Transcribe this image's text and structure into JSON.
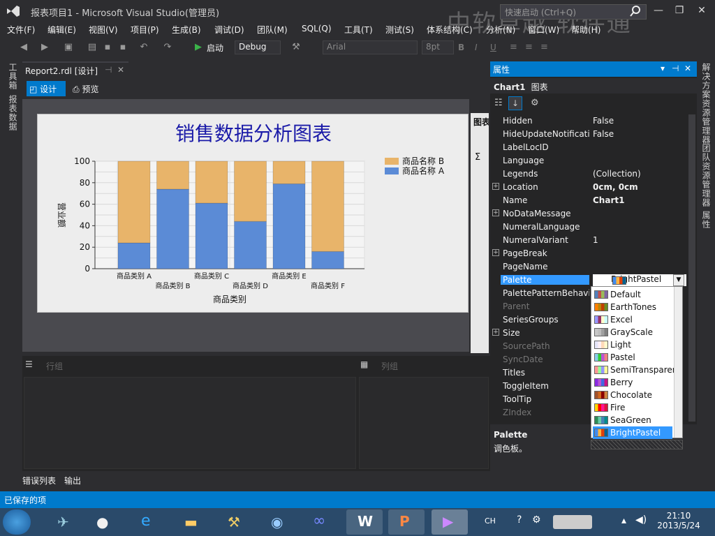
{
  "window": {
    "title": "报表项目1 - Microsoft Visual Studio(管理员)",
    "quick_launch_placeholder": "快速启动 (Ctrl+Q)",
    "watermark": "中软卓越 软件通"
  },
  "menu": [
    "文件(F)",
    "编辑(E)",
    "视图(V)",
    "项目(P)",
    "生成(B)",
    "调试(D)",
    "团队(M)",
    "SQL(Q)",
    "工具(T)",
    "测试(S)",
    "体系结构(C)",
    "分析(N)",
    "窗口(W)",
    "帮助(H)"
  ],
  "toolbar": {
    "start_label": "启动",
    "config": "Debug",
    "font": "Arial",
    "font_size": "8pt"
  },
  "left_strip": {
    "toolbox": "工具箱",
    "report_data": "报表数据"
  },
  "document": {
    "tab_title": "Report2.rdl [设计]",
    "design_tab": "设计",
    "preview_tab": "预览"
  },
  "side_panel": {
    "title": "图表"
  },
  "chart_data": {
    "type": "bar",
    "stacked": true,
    "title": "销售数据分析图表",
    "xlabel": "商品类别",
    "ylabel": "营业额",
    "ylim": [
      0,
      100
    ],
    "yticks": [
      0,
      20,
      40,
      60,
      80,
      100
    ],
    "categories": [
      "商品类别 A",
      "商品类别 B",
      "商品类别 C",
      "商品类别 D",
      "商品类别 E",
      "商品类别 F"
    ],
    "series": [
      {
        "name": "商品名称 A",
        "color": "#5b8bd6",
        "values": [
          24,
          74,
          61,
          44,
          79,
          16
        ]
      },
      {
        "name": "商品名称 B",
        "color": "#e8b46a",
        "values": [
          76,
          26,
          39,
          56,
          21,
          84
        ]
      }
    ],
    "legend": [
      "商品名称 B",
      "商品名称 A"
    ],
    "legend_position": "top-right",
    "grid": true
  },
  "groups": {
    "row_groups": "行组",
    "column_groups": "列组"
  },
  "bottom_tabs": [
    "错误列表",
    "输出"
  ],
  "status": "已保存的项",
  "properties": {
    "panel_title": "属性",
    "object": "Chart1",
    "object_type": "图表",
    "rows": [
      {
        "name": "Hidden",
        "value": "False",
        "expandable": false,
        "dim": false,
        "bold": false
      },
      {
        "name": "HideUpdateNotifications",
        "value": "False",
        "expandable": false,
        "dim": false,
        "bold": false
      },
      {
        "name": "LabelLocID",
        "value": "",
        "expandable": false,
        "dim": false,
        "bold": false
      },
      {
        "name": "Language",
        "value": "",
        "expandable": false,
        "dim": false,
        "bold": false
      },
      {
        "name": "Legends",
        "value": "(Collection)",
        "expandable": false,
        "dim": false,
        "bold": false
      },
      {
        "name": "Location",
        "value": "0cm, 0cm",
        "expandable": true,
        "dim": false,
        "bold": true
      },
      {
        "name": "Name",
        "value": "Chart1",
        "expandable": false,
        "dim": false,
        "bold": true
      },
      {
        "name": "NoDataMessage",
        "value": "",
        "expandable": true,
        "dim": false,
        "bold": false
      },
      {
        "name": "NumeralLanguage",
        "value": "",
        "expandable": false,
        "dim": false,
        "bold": false
      },
      {
        "name": "NumeralVariant",
        "value": "1",
        "expandable": false,
        "dim": false,
        "bold": false
      },
      {
        "name": "PageBreak",
        "value": "",
        "expandable": true,
        "dim": false,
        "bold": false
      },
      {
        "name": "PageName",
        "value": "",
        "expandable": false,
        "dim": false,
        "bold": false
      },
      {
        "name": "Palette",
        "value": "BrightPastel",
        "expandable": false,
        "dim": false,
        "bold": false,
        "selected": true
      },
      {
        "name": "PalettePatternBehavior",
        "value": "",
        "expandable": false,
        "dim": false,
        "bold": false
      },
      {
        "name": "Parent",
        "value": "",
        "expandable": false,
        "dim": true,
        "bold": false
      },
      {
        "name": "SeriesGroups",
        "value": "",
        "expandable": false,
        "dim": false,
        "bold": false
      },
      {
        "name": "Size",
        "value": "",
        "expandable": true,
        "dim": false,
        "bold": false
      },
      {
        "name": "SourcePath",
        "value": "",
        "expandable": false,
        "dim": true,
        "bold": false
      },
      {
        "name": "SyncDate",
        "value": "",
        "expandable": false,
        "dim": true,
        "bold": false
      },
      {
        "name": "Titles",
        "value": "",
        "expandable": false,
        "dim": false,
        "bold": false
      },
      {
        "name": "ToggleItem",
        "value": "",
        "expandable": false,
        "dim": false,
        "bold": false
      },
      {
        "name": "ToolTip",
        "value": "",
        "expandable": false,
        "dim": false,
        "bold": false
      },
      {
        "name": "ZIndex",
        "value": "",
        "expandable": false,
        "dim": true,
        "bold": false
      }
    ],
    "desc_title": "Palette",
    "desc_text": "调色板。"
  },
  "palette_options": [
    {
      "name": "Default",
      "colors": [
        "#4f81bd",
        "#c0504d",
        "#9bbb59",
        "#8064a2"
      ]
    },
    {
      "name": "EarthTones",
      "colors": [
        "#ff8000",
        "#b8860b",
        "#c04000",
        "#6b8e23"
      ]
    },
    {
      "name": "Excel",
      "colors": [
        "#9999ff",
        "#993366",
        "#ffffcc",
        "#ccffff"
      ]
    },
    {
      "name": "GrayScale",
      "colors": [
        "#c8c8c8",
        "#bdbdbd",
        "#a0a0a0",
        "#808080"
      ]
    },
    {
      "name": "Light",
      "colors": [
        "#e6e6fa",
        "#fff0f5",
        "#ffdab9",
        "#fffacd"
      ]
    },
    {
      "name": "Pastel",
      "colors": [
        "#87ceeb",
        "#32cd32",
        "#ba55d3",
        "#f08080"
      ]
    },
    {
      "name": "SemiTransparent",
      "colors": [
        "#ff9696",
        "#96ff96",
        "#9696ff",
        "#ffff96"
      ]
    },
    {
      "name": "Berry",
      "colors": [
        "#8a2be2",
        "#ba55d3",
        "#4169e1",
        "#c71585"
      ]
    },
    {
      "name": "Chocolate",
      "colors": [
        "#a0522d",
        "#d2691e",
        "#8b0000",
        "#cd853f"
      ]
    },
    {
      "name": "Fire",
      "colors": [
        "#ffd700",
        "#ff0000",
        "#ff1493",
        "#dc143c"
      ]
    },
    {
      "name": "SeaGreen",
      "colors": [
        "#2e8b57",
        "#66cdaa",
        "#4682b4",
        "#008b8b"
      ]
    },
    {
      "name": "BrightPastel",
      "colors": [
        "#418cf0",
        "#fcb441",
        "#e0400a",
        "#056492"
      ],
      "selected": true
    }
  ],
  "right_strip": {
    "solution": "解决方案资源管理器",
    "team": "团队资源管理器",
    "props": "属性"
  },
  "taskbar": {
    "time": "21:10",
    "date": "2013/5/24",
    "lang": "CH"
  }
}
